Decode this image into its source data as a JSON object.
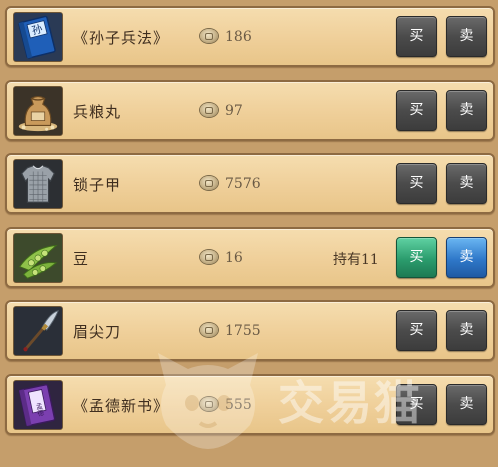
{
  "items": [
    {
      "name": "《孙子兵法》",
      "price": "186",
      "holding": "",
      "icon": "blue-book-icon",
      "icon_char": "孙",
      "buy_label": "买",
      "sell_label": "卖",
      "buy_active": false,
      "sell_active": false
    },
    {
      "name": "兵粮丸",
      "price": "97",
      "holding": "",
      "icon": "grain-sack-icon",
      "icon_char": "",
      "buy_label": "买",
      "sell_label": "卖",
      "buy_active": false,
      "sell_active": false
    },
    {
      "name": "锁子甲",
      "price": "7576",
      "holding": "",
      "icon": "chainmail-armor-icon",
      "icon_char": "",
      "buy_label": "买",
      "sell_label": "卖",
      "buy_active": false,
      "sell_active": false
    },
    {
      "name": "豆",
      "price": "16",
      "holding": "持有11",
      "icon": "bean-pod-icon",
      "icon_char": "",
      "buy_label": "买",
      "sell_label": "卖",
      "buy_active": true,
      "sell_active": true
    },
    {
      "name": "眉尖刀",
      "price": "1755",
      "holding": "",
      "icon": "glaive-icon",
      "icon_char": "",
      "buy_label": "买",
      "sell_label": "卖",
      "buy_active": false,
      "sell_active": false
    },
    {
      "name": "《孟德新书》",
      "price": "555",
      "holding": "",
      "icon": "purple-book-icon",
      "icon_char": "孟德",
      "buy_label": "买",
      "sell_label": "卖",
      "buy_active": false,
      "sell_active": false
    }
  ],
  "watermark": {
    "text": "交易猫",
    "icon": "cat-logo-icon"
  },
  "colors": {
    "row_background": "#f0d29e",
    "row_border": "#8d6a42",
    "button_default": "#4b4b4b",
    "button_buy_active": "#2b9c6d",
    "button_sell_active": "#2f78c9"
  }
}
